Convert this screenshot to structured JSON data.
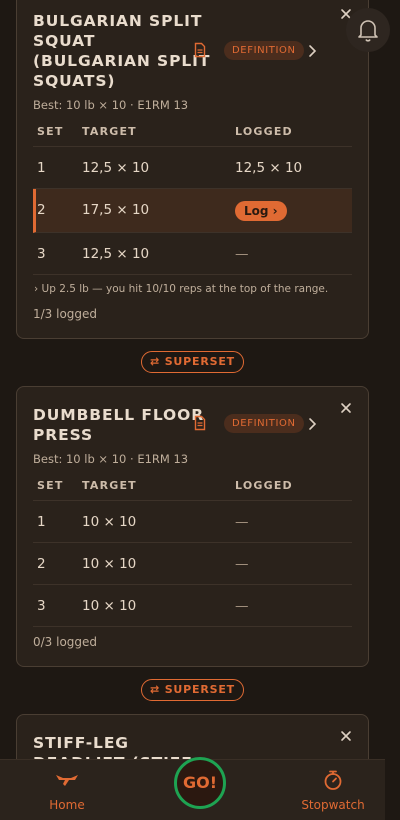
{
  "table_headers": {
    "set": "SET",
    "target": "TARGET",
    "logged": "LOGGED"
  },
  "definition_label": "DEFINITION",
  "superset_label": "SUPERSET",
  "exercises": [
    {
      "title_lines": [
        "BULGARIAN SPLIT",
        "SQUAT",
        "(BULGARIAN SPLIT",
        "SQUATS)"
      ],
      "best": "Best: 10 lb × 10 · E1RM 13",
      "sets": [
        {
          "set": "1",
          "target": "12,5 × 10",
          "logged": "12,5 × 10"
        },
        {
          "set": "2",
          "target": "17,5 × 10",
          "logged": "Log ›",
          "active": true
        },
        {
          "set": "3",
          "target": "12,5 × 10",
          "logged": "—"
        }
      ],
      "hint": "›  Up 2.5 lb — you hit 10/10 reps at the top of the range.",
      "logged_count": "1/3 logged"
    },
    {
      "title_lines": [
        "DUMBBELL FLOOR",
        "PRESS"
      ],
      "best": "Best: 10 lb × 10 · E1RM 13",
      "sets": [
        {
          "set": "1",
          "target": "10 × 10",
          "logged": "—"
        },
        {
          "set": "2",
          "target": "10 × 10",
          "logged": "—"
        },
        {
          "set": "3",
          "target": "10 × 10",
          "logged": "—"
        }
      ],
      "logged_count": "0/3 logged"
    },
    {
      "title_lines": [
        "STIFF-LEG",
        "DEADLIFT (STIFF"
      ]
    }
  ],
  "nav": {
    "home_label": "Home",
    "go_label": "GO!",
    "stopwatch_label": "Stopwatch"
  },
  "colors": {
    "accent": "#e06a33",
    "go_ring": "#1ea352",
    "background": "#1e1813",
    "card": "#2a221b"
  },
  "icons": [
    "close-icon",
    "note-icon",
    "chevron-right-icon",
    "bell-icon",
    "swap-icon",
    "barbell-icon",
    "stopwatch-icon"
  ]
}
